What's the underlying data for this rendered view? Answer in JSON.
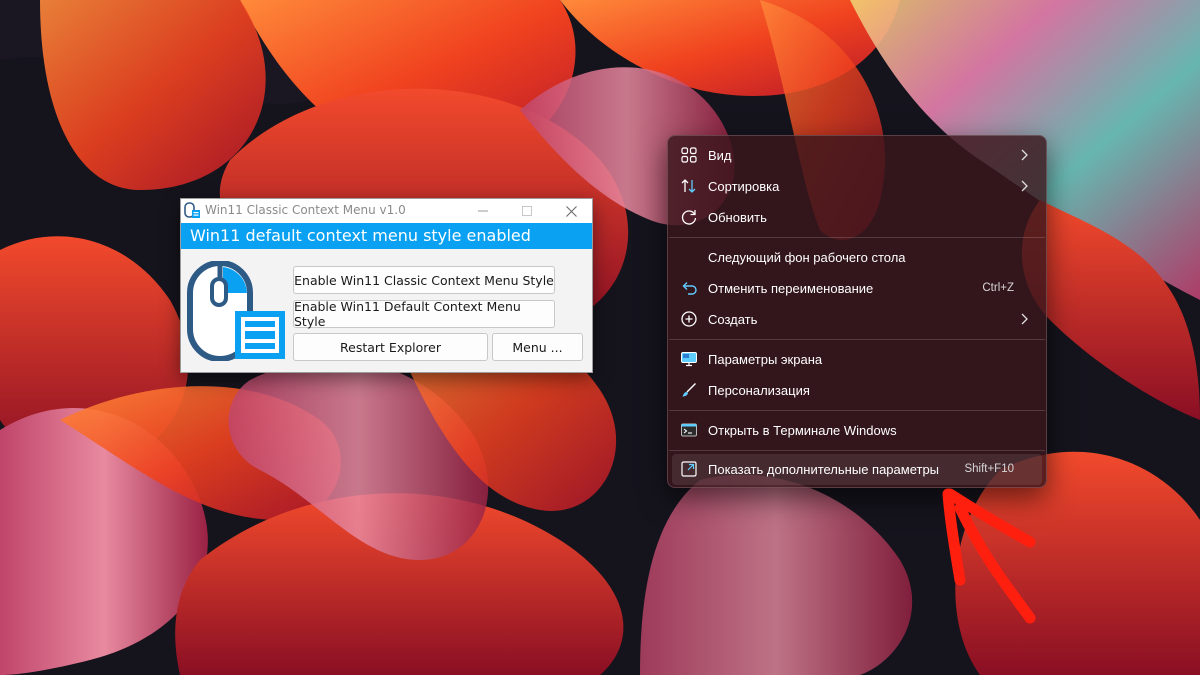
{
  "app": {
    "title": "Win11 Classic Context Menu v1.0",
    "status": "Win11 default context menu style enabled",
    "buttons": {
      "classic": "Enable Win11 Classic Context Menu Style",
      "default": "Enable Win11 Default Context Menu Style",
      "restart": "Restart Explorer",
      "menu": "Menu ..."
    },
    "colors": {
      "accent": "#0aa1f2",
      "logo_dark": "#2e5a86"
    }
  },
  "context_menu": {
    "items": [
      {
        "label": "Вид",
        "icon": "grid-view-icon",
        "submenu": true
      },
      {
        "label": "Сортировка",
        "icon": "sort-icon",
        "submenu": true
      },
      {
        "label": "Обновить",
        "icon": "refresh-icon"
      },
      {
        "label": "Следующий фон рабочего стола",
        "icon": ""
      },
      {
        "label": "Отменить переименование",
        "icon": "undo-icon",
        "shortcut": "Ctrl+Z"
      },
      {
        "label": "Создать",
        "icon": "plus-circle-icon",
        "submenu": true
      },
      {
        "label": "Параметры экрана",
        "icon": "display-icon"
      },
      {
        "label": "Персонализация",
        "icon": "brush-icon"
      },
      {
        "label": "Открыть в Терминале Windows",
        "icon": "terminal-icon"
      },
      {
        "label": "Показать дополнительные параметры",
        "icon": "expand-icon",
        "shortcut": "Shift+F10",
        "highlighted": true
      }
    ],
    "colors": {
      "menu_bg": "#3a161c",
      "text": "#ffffff",
      "icon_accent": "#60cdff"
    }
  },
  "annotation": {
    "color": "#ff1f0f",
    "icon": "red-arrow-icon"
  }
}
